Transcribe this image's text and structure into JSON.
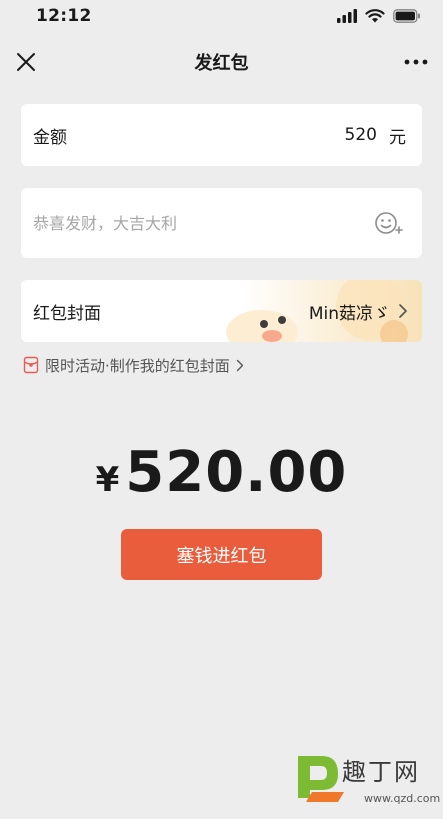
{
  "status_bar": {
    "time": "12:12"
  },
  "nav": {
    "title": "发红包"
  },
  "amount": {
    "label": "金额",
    "value": "520",
    "unit": "元"
  },
  "greeting": {
    "placeholder": "恭喜发财，大吉大利"
  },
  "cover": {
    "label": "红包封面",
    "selected": "Min菇凉ゞ"
  },
  "promo": {
    "text": "限时活动·制作我的红包封面"
  },
  "total": {
    "currency": "¥",
    "value": "520.00"
  },
  "action": {
    "label": "塞钱进红包"
  },
  "watermark": {
    "text": "趣丁网",
    "url": "www.qzd.com"
  },
  "colors": {
    "accent": "#e95c3c",
    "background": "#ededed",
    "promo_icon": "#e35d55"
  },
  "icons": [
    "close-icon",
    "more-icon",
    "emoji-add-icon",
    "chevron-right-icon",
    "red-packet-icon",
    "signal-icon",
    "wifi-icon",
    "battery-icon"
  ]
}
